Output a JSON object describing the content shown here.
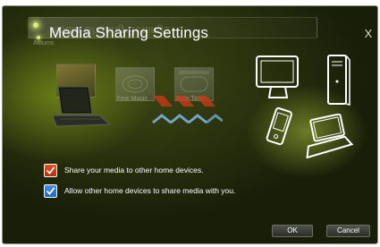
{
  "dialog": {
    "title": "Media Sharing Settings",
    "title_reflection": "Media Sharing Settings",
    "close_label": "X"
  },
  "media_thumbnails": [
    {
      "label": "Albums"
    },
    {
      "label": "Fine Music"
    },
    {
      "label": "Help Time"
    }
  ],
  "devices": [
    "laptop-icon",
    "monitor-icon",
    "tower-pc-icon",
    "phone-icon",
    "small-laptop-icon"
  ],
  "options": [
    {
      "label": "Share your media to other home devices.",
      "checked": true,
      "color": "#c8401f"
    },
    {
      "label": "Allow other home devices to share media with you.",
      "checked": true,
      "color": "#2f74cf"
    }
  ],
  "buttons": {
    "ok": "OK",
    "cancel": "Cancel"
  },
  "colors": {
    "accent_green": "#b7d23a",
    "background": "#2a3210"
  }
}
